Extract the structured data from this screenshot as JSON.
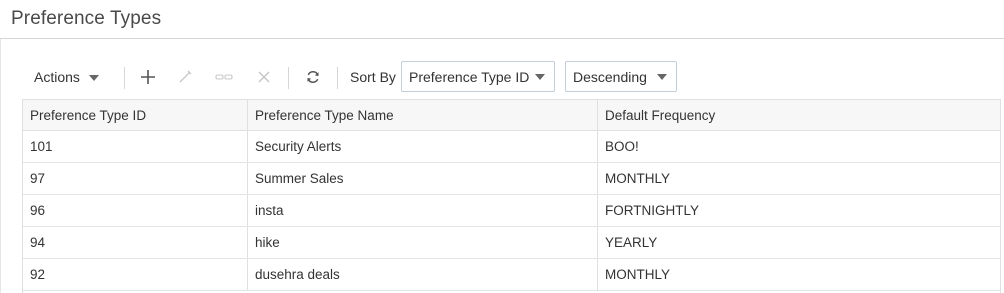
{
  "page": {
    "title": "Preference Types"
  },
  "toolbar": {
    "actions_label": "Actions",
    "icons": [
      "add-icon",
      "edit-icon",
      "link-icon",
      "delete-icon",
      "refresh-icon"
    ],
    "sort_by_label": "Sort By",
    "sort_field": "Preference Type ID",
    "sort_order": "Descending"
  },
  "table": {
    "columns": [
      "Preference Type ID",
      "Preference Type Name",
      "Default Frequency"
    ],
    "rows": [
      [
        "101",
        "Security Alerts",
        "BOO!"
      ],
      [
        "97",
        "Summer Sales",
        "MONTHLY"
      ],
      [
        "96",
        "insta",
        "FORTNIGHTLY"
      ],
      [
        "94",
        "hike",
        "YEARLY"
      ],
      [
        "92",
        "dusehra deals",
        "MONTHLY"
      ]
    ]
  },
  "colors": {
    "border": "#e0e0e0",
    "header_bg": "#f7f7f7",
    "icon_active": "#555555",
    "icon_disabled": "#c8c8c8"
  }
}
